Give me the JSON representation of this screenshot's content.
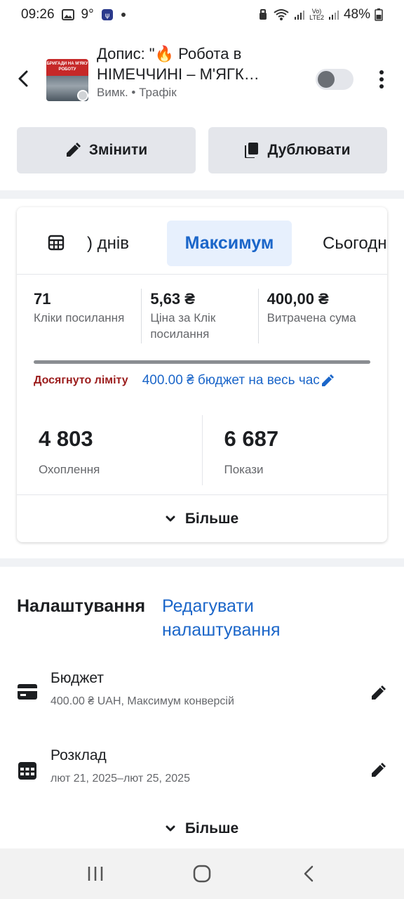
{
  "status_bar": {
    "time": "09:26",
    "temp": "9°",
    "battery": "48%",
    "network": "LTE2",
    "signal_note": "Vo)"
  },
  "header": {
    "title_line1": "Допис: \"🔥 Робота в",
    "title_line2": "НІМЕЧЧИНІ – М'ЯГК…",
    "subtitle_status": "Вимк.",
    "subtitle_objective": "Трафік",
    "thumbnail_banner": "БРИГАДИ НА М'ЯКУ РОБОТУ"
  },
  "actions": {
    "edit_label": "Змінити",
    "duplicate_label": "Дублювати"
  },
  "tabs": {
    "days_label": ") днів",
    "max_label": "Максимум",
    "today_label": "Сьогодні"
  },
  "metrics": [
    {
      "value": "71",
      "label": "Кліки посилання"
    },
    {
      "value": "5,63 ₴",
      "label": "Ціна за Клік посилання"
    },
    {
      "value": "400,00 ₴",
      "label": "Витрачена сума"
    }
  ],
  "budget": {
    "limit_text": "Досягнуто ліміту",
    "budget_text": "400.00 ₴ бюджет на весь час",
    "progress": 1.0
  },
  "big_stats": [
    {
      "value": "4 803",
      "label": "Охоплення"
    },
    {
      "value": "6 687",
      "label": "Покази"
    }
  ],
  "card_more_label": "Більше",
  "settings": {
    "title": "Налаштування",
    "edit_link": "Редагувати налаштування",
    "rows": [
      {
        "name": "Бюджет",
        "desc": "400.00 ₴ UAH, Максимум конверсій",
        "icon": "card-icon"
      },
      {
        "name": "Розклад",
        "desc": "лют 21, 2025–лют 25, 2025",
        "icon": "calendar-icon"
      }
    ],
    "more_label": "Більше"
  },
  "colors": {
    "accent": "#1b66c9",
    "limit": "#9b1c1c",
    "button_bg": "#e4e6eb",
    "tab_active_bg": "#e7f0fd"
  }
}
